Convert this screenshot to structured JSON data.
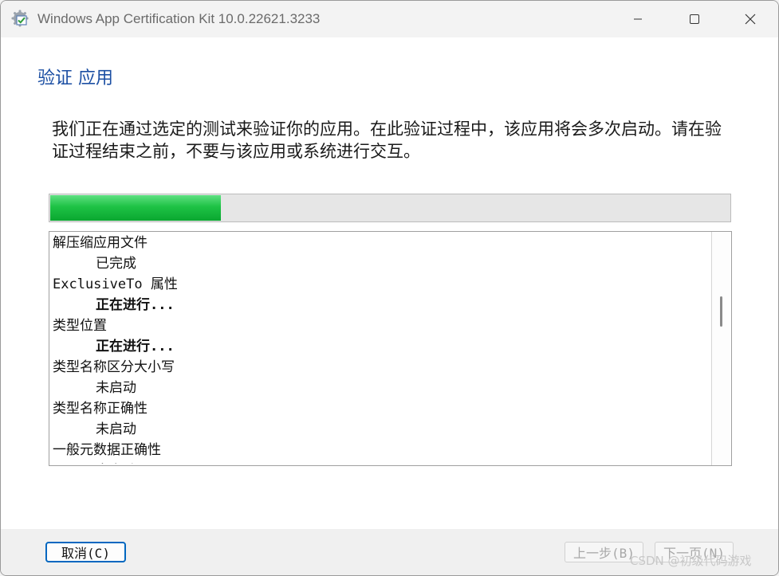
{
  "window": {
    "title": "Windows App Certification Kit 10.0.22621.3233",
    "icon": "gear-checkmark-icon"
  },
  "page": {
    "heading": "验证 应用",
    "description": "我们正在通过选定的测试来验证你的应用。在此验证过程中，该应用将会多次启动。请在验证过程结束之前，不要与该应用或系统进行交互。"
  },
  "progress": {
    "percent": 25,
    "color": "#13b83a"
  },
  "log": {
    "items": [
      {
        "text": "解压缩应用文件",
        "indent": false,
        "bold": false
      },
      {
        "text": "已完成",
        "indent": true,
        "bold": false
      },
      {
        "text": "ExclusiveTo 属性",
        "indent": false,
        "bold": false
      },
      {
        "text": "正在进行...",
        "indent": true,
        "bold": true
      },
      {
        "text": "类型位置",
        "indent": false,
        "bold": false
      },
      {
        "text": "正在进行...",
        "indent": true,
        "bold": true
      },
      {
        "text": "类型名称区分大小写",
        "indent": false,
        "bold": false
      },
      {
        "text": "未启动",
        "indent": true,
        "bold": false
      },
      {
        "text": "类型名称正确性",
        "indent": false,
        "bold": false
      },
      {
        "text": "未启动",
        "indent": true,
        "bold": false
      },
      {
        "text": "一般元数据正确性",
        "indent": false,
        "bold": false
      },
      {
        "text": "未启动",
        "indent": true,
        "bold": false
      }
    ]
  },
  "buttons": {
    "cancel": "取消(C)",
    "prev": "上一步(B)",
    "next": "下一页(N)"
  },
  "watermark": "CSDN @初级代码游戏",
  "colors": {
    "heading": "#1c4fa3",
    "accent": "#0067c0"
  }
}
